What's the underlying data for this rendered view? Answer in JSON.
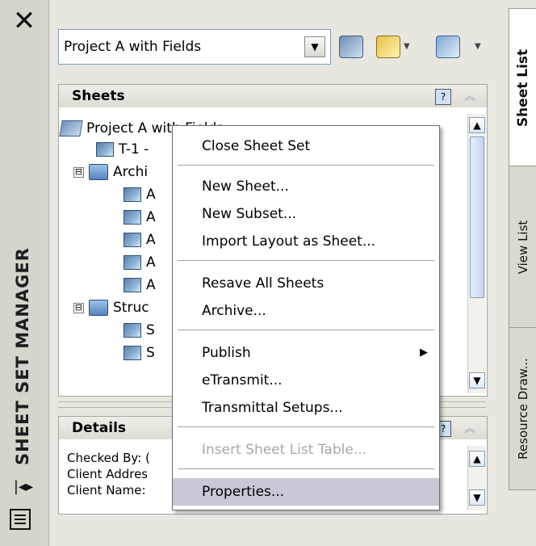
{
  "palette": {
    "title": "SHEET SET MANAGER",
    "close_icon": "close-icon",
    "tabs": [
      "Sheet List",
      "View List",
      "Resource Draw..."
    ]
  },
  "toolbar": {
    "sheet_set_select": "Project A with Fields"
  },
  "sheets_panel": {
    "header": "Sheets",
    "root": "Project A with Fields",
    "rows": [
      {
        "kind": "sheet",
        "label": "T-1 -",
        "indent": 1
      },
      {
        "kind": "subset",
        "label": "Archi",
        "indent": 1,
        "expanded": "⊟"
      },
      {
        "kind": "sheet",
        "label": "A",
        "indent": 2
      },
      {
        "kind": "sheet",
        "label": "A",
        "indent": 2
      },
      {
        "kind": "sheet",
        "label": "A",
        "indent": 2
      },
      {
        "kind": "sheet",
        "label": "A",
        "indent": 2
      },
      {
        "kind": "sheet",
        "label": "A",
        "indent": 2
      },
      {
        "kind": "subset",
        "label": "Struc",
        "indent": 1,
        "expanded": "⊟"
      },
      {
        "kind": "sheet",
        "label": "S",
        "indent": 2
      },
      {
        "kind": "sheet",
        "label": "S",
        "indent": 2
      }
    ]
  },
  "details_panel": {
    "header": "Details",
    "rows": [
      "Checked By: (",
      "Client Addres",
      "Client Name:"
    ]
  },
  "context_menu": {
    "items": [
      {
        "label": "Close Sheet Set",
        "enabled": true
      },
      {
        "label": "New Sheet...",
        "enabled": true
      },
      {
        "label": "New Subset...",
        "enabled": true
      },
      {
        "label": "Import Layout as Sheet...",
        "enabled": true
      },
      {
        "label": "Resave All Sheets",
        "enabled": true
      },
      {
        "label": "Archive...",
        "enabled": true
      },
      {
        "label": "Publish",
        "enabled": true,
        "submenu": "▶"
      },
      {
        "label": "eTransmit...",
        "enabled": true
      },
      {
        "label": "Transmittal Setups...",
        "enabled": true
      },
      {
        "label": "Insert Sheet List Table...",
        "enabled": false
      },
      {
        "label": "Properties...",
        "enabled": true,
        "highlighted": true
      }
    ]
  }
}
